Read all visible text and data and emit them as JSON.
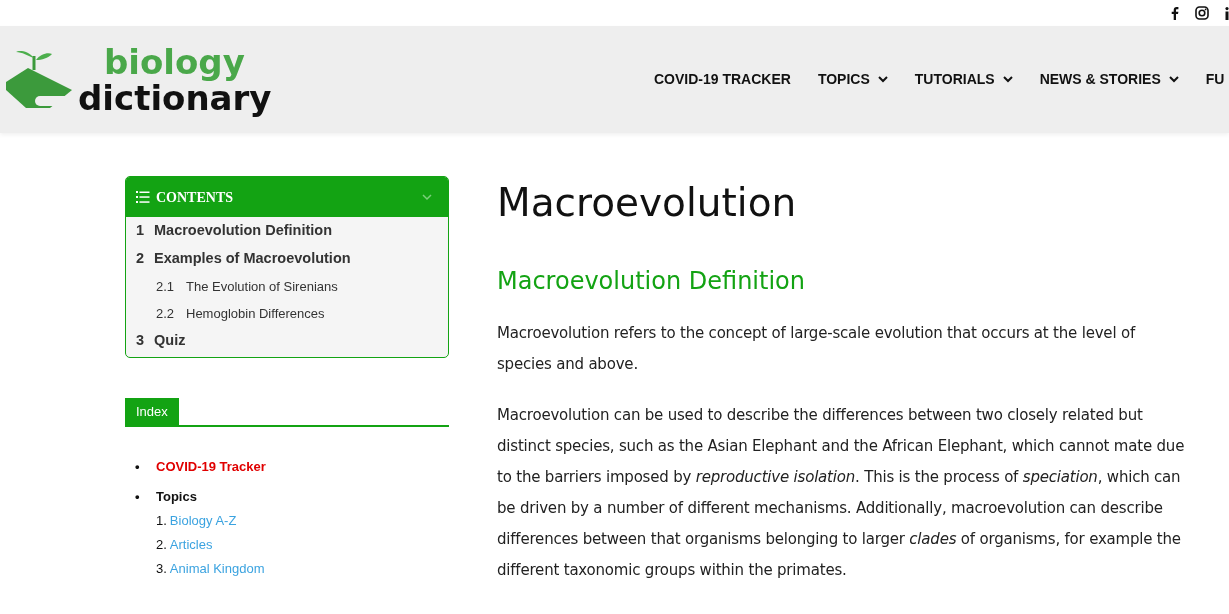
{
  "logo": {
    "top": "biology",
    "bottom": "dictionary"
  },
  "nav": [
    {
      "label": "COVID-19 TRACKER",
      "dropdown": false
    },
    {
      "label": "TOPICS",
      "dropdown": true
    },
    {
      "label": "TUTORIALS",
      "dropdown": true
    },
    {
      "label": "NEWS & STORIES",
      "dropdown": true
    },
    {
      "label": "FU",
      "dropdown": false
    }
  ],
  "toc": {
    "title": "CONTENTS",
    "expanded": true,
    "items": [
      {
        "number": "1",
        "label": "Macroevolution Definition"
      },
      {
        "number": "2",
        "label": "Examples of Macroevolution",
        "children": [
          {
            "number": "2.1",
            "label": "The Evolution of Sirenians"
          },
          {
            "number": "2.2",
            "label": "Hemoglobin Differences"
          }
        ]
      },
      {
        "number": "3",
        "label": "Quiz"
      }
    ]
  },
  "index": {
    "title": "Index",
    "items": [
      {
        "bullet": "•",
        "label": "COVID-19 Tracker",
        "highlight": true
      },
      {
        "bullet": "•",
        "label": "Topics",
        "highlight": false,
        "children": [
          {
            "number": "1.",
            "label": "Biology A-Z"
          },
          {
            "number": "2.",
            "label": "Articles"
          },
          {
            "number": "3.",
            "label": "Animal Kingdom"
          }
        ]
      }
    ]
  },
  "article": {
    "title": "Macroevolution",
    "section": "Macroevolution Definition",
    "paragraphs": [
      "Macroevolution refers to the concept of large-scale evolution that occurs at the level of species and above.",
      "Macroevolution can be used to describe the differences between two closely related but distinct species, such as the Asian Elephant and the African Elephant, which cannot mate due to the barriers imposed by *reproductive isolation*. This is the process of *speciation*, which can be driven by a number of different mechanisms. Additionally, macroevolution can describe differences between that organisms belonging to larger *clades* of organisms, for example the different taxonomic groups within the primates."
    ]
  }
}
